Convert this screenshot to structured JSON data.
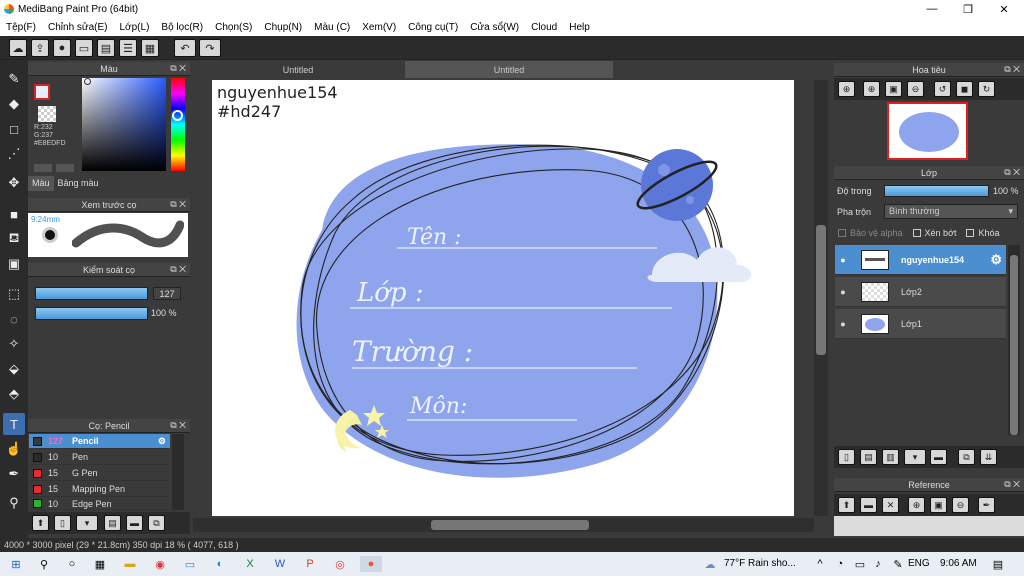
{
  "window": {
    "title": "MediBang Paint Pro (64bit)"
  },
  "menu": [
    "Tệp(F)",
    "Chỉnh sửa(E)",
    "Lớp(L)",
    "Bộ lọc(R)",
    "Chọn(S)",
    "Chụp(N)",
    "Màu (C)",
    "Xem(V)",
    "Công cụ(T)",
    "Cửa sổ(W)",
    "Cloud",
    "Help"
  ],
  "tabs": [
    "Untitled",
    "Untitled"
  ],
  "color_panel": {
    "title": "Màu",
    "rgb": [
      "R:232",
      "G:237",
      "#E8EDFD"
    ],
    "tabs": [
      "Màu",
      "Bảng màu"
    ],
    "primary_color": "#E8EDFD"
  },
  "brush_preview": {
    "title": "Xem trước cọ",
    "size": "9.24mm"
  },
  "brush_control": {
    "title": "Kiểm soát cọ",
    "size_value": "127",
    "opacity_value": "100 %"
  },
  "brush_list": {
    "title": "Cọ: Pencil",
    "items": [
      {
        "num": "127",
        "name": "Pencil",
        "color": "#3a3a3a"
      },
      {
        "num": "10",
        "name": "Pen",
        "color": "#2b2b2b"
      },
      {
        "num": "15",
        "name": "G Pen",
        "color": "#e03030"
      },
      {
        "num": "15",
        "name": "Mapping Pen",
        "color": "#e03030"
      },
      {
        "num": "10",
        "name": "Edge Pen",
        "color": "#30b030"
      }
    ]
  },
  "canvas": {
    "watermark_line1": "nguyenhue154",
    "watermark_line2": "#hd247",
    "fields": [
      "Tên :",
      "Lớp :",
      "Trường :",
      "Môn:"
    ],
    "blob_color": "#8ea4ec"
  },
  "navigator": {
    "title": "Hoa tiêu"
  },
  "layers_panel": {
    "title": "Lớp",
    "opacity_label": "Độ trong",
    "opacity_value": "100 %",
    "blend_label": "Pha trộn",
    "blend_value": "Bình thường",
    "options": [
      "Bảo vệ alpha",
      "Xén bớt",
      "Khóa"
    ],
    "layers": [
      "nguyenhue154",
      "Lớp2",
      "Lớp1"
    ]
  },
  "reference": {
    "title": "Reference"
  },
  "status": "4000 * 3000 pixel  (29 * 21.8cm)  350 dpi  18 %  ( 4077, 618 )",
  "taskbar": {
    "weather": "77°F  Rain sho...",
    "lang": "ENG",
    "time": "9:06 AM"
  }
}
